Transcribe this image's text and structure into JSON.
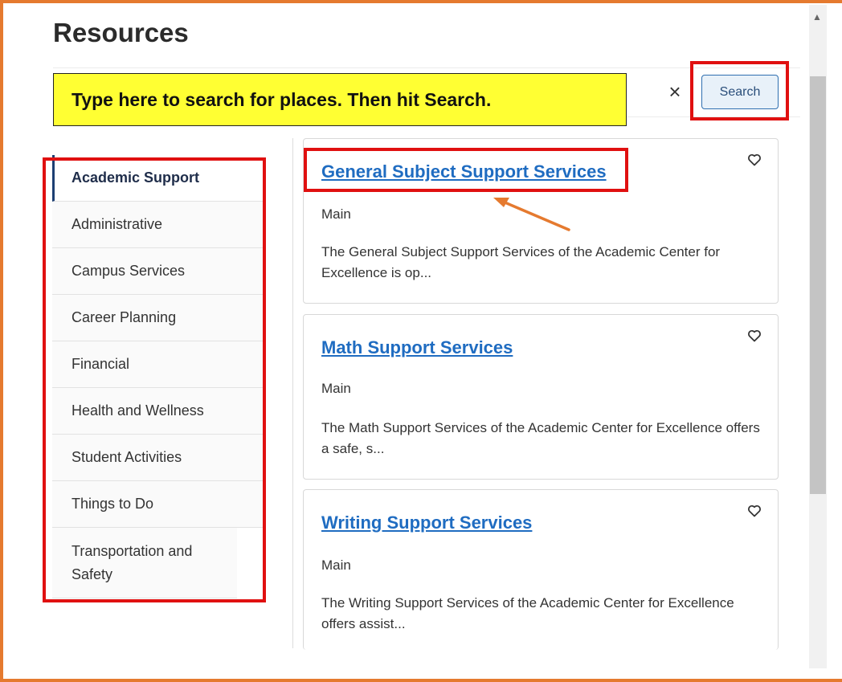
{
  "page_title": "Resources",
  "search": {
    "placeholder": "",
    "button_label": "Search",
    "clear_icon": "close-icon"
  },
  "callout": {
    "text": "Type here to search for places. Then hit Search."
  },
  "sidebar": {
    "items": [
      {
        "label": "Academic Support",
        "active": true
      },
      {
        "label": "Administrative"
      },
      {
        "label": "Campus Services"
      },
      {
        "label": "Career Planning"
      },
      {
        "label": "Financial"
      },
      {
        "label": "Health and Wellness"
      },
      {
        "label": "Student Activities"
      },
      {
        "label": "Things to Do"
      },
      {
        "label": "Transportation and Safety"
      }
    ]
  },
  "results": [
    {
      "title": "General Subject Support Services",
      "location": "Main",
      "description": "The General Subject Support Services of the Academic Center for Excellence is op..."
    },
    {
      "title": "Math Support Services",
      "location": "Main",
      "description": "The Math Support Services of the Academic Center for Excellence offers a safe, s..."
    },
    {
      "title": "Writing Support Services",
      "location": "Main",
      "description": "The Writing Support Services of the Academic Center for Excellence offers assist..."
    }
  ],
  "colors": {
    "frame": "#e57a2f",
    "highlight": "#e01010",
    "callout_bg": "#ffff33",
    "link": "#1f6cc1",
    "arrow": "#e57a2f"
  }
}
